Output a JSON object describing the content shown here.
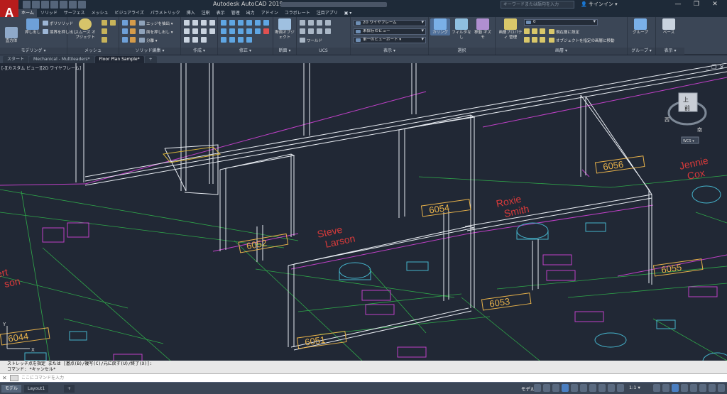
{
  "app": {
    "logo": "A",
    "title": "Autodesk AutoCAD 2019 - ",
    "search_placeholder": "キーワードまたは語句を入力",
    "user": "サインイン",
    "quick_access_icons": [
      "new-icon",
      "open-icon",
      "save-icon",
      "saveas-icon",
      "print-icon",
      "undo-icon",
      "redo-icon"
    ]
  },
  "window": {
    "minimize": "—",
    "restore": "❐",
    "close": "✕"
  },
  "ribbon_tabs": [
    {
      "label": "ホーム",
      "active": true
    },
    {
      "label": "ソリッド"
    },
    {
      "label": "サーフェス"
    },
    {
      "label": "メッシュ"
    },
    {
      "label": "ビジュアライズ"
    },
    {
      "label": "パラメトリック"
    },
    {
      "label": "挿入"
    },
    {
      "label": "注釈"
    },
    {
      "label": "表示"
    },
    {
      "label": "管理"
    },
    {
      "label": "出力"
    },
    {
      "label": "アドイン"
    },
    {
      "label": "コラボレート"
    },
    {
      "label": "注目アプリ"
    },
    {
      "label": "▣ ▾"
    }
  ],
  "ribbon": {
    "modeling": {
      "title": "モデリング ▾",
      "box": "直方体",
      "extrude": "押し出し",
      "polysolid": "ポリソリッド",
      "presspull": "境界を押し出し"
    },
    "mesh": {
      "title": "メッシュ",
      "smooth": "スムーズ オブジェクト"
    },
    "solid_edit": {
      "title": "ソリッド編集 ▾",
      "edge": "エッジを抽出 ▾",
      "face": "面を押し出し ▾",
      "separate": "分離 ▾"
    },
    "draw": {
      "title": "作成 ▾"
    },
    "modify": {
      "title": "修正 ▾"
    },
    "section": {
      "title": "断面 ▾",
      "plane": "断面オブジェクト"
    },
    "ucs": {
      "title": "UCS",
      "world": "ワールド"
    },
    "view": {
      "title": "表示 ▾",
      "visual_style": "2D ワイヤフレーム",
      "saved_view": "未保存のビュー",
      "single_viewport": "単一のビューポート ▾"
    },
    "selection": {
      "title": "選択",
      "culling": "カリング",
      "filter": "フィルタなし",
      "gizmo": "移動 ギズモ"
    },
    "layers": {
      "title": "画層 ▾",
      "properties": "画層プロパティ 管理",
      "current_layer": "0",
      "make_current": "現在層に設定",
      "match": "オブジェクトを指定の画層に移動"
    },
    "groups": {
      "title": "グループ ▾",
      "group": "グループ"
    },
    "base_view": {
      "title": "表示 ▾",
      "base": "ベース"
    }
  },
  "doc_tabs": [
    {
      "label": "スタート"
    },
    {
      "label": "Mechanical - Multileaders*"
    },
    {
      "label": "Floor Plan Sample*",
      "active": true
    },
    {
      "label": "+"
    }
  ],
  "viewport": {
    "label": "[-][カスタム ビュー][2D ワイヤフレーム]",
    "controls": {
      "minimize": "_",
      "restore": "❐",
      "close": "✕"
    },
    "viewcube": {
      "top": "上",
      "front": "前",
      "west": "西",
      "south": "南",
      "wcs": "WCS ▾"
    },
    "rooms": [
      {
        "number": "6051",
        "color": "#e8b24a"
      },
      {
        "number": "6052",
        "color": "#e8b24a"
      },
      {
        "number": "6053",
        "color": "#e8b24a"
      },
      {
        "number": "6054",
        "color": "#e8b24a"
      },
      {
        "number": "6055",
        "color": "#e8b24a"
      },
      {
        "number": "6056",
        "color": "#e8b24a"
      },
      {
        "number": "6044",
        "color": "#e8b24a"
      }
    ],
    "names": [
      {
        "first": "Steve",
        "last": "Larson"
      },
      {
        "first": "Roxie",
        "last": "Smith"
      },
      {
        "first": "Jennie",
        "last": "Cox"
      },
      {
        "first": "ert",
        "last": "son"
      }
    ],
    "ucs": {
      "x": "X",
      "y": "Y"
    }
  },
  "command": {
    "history1": "ストレッチ点を指定 または [基点(B)/複写(C)/元に戻す(U)/終了(X)]:",
    "history2": "コマンド: *キャンセル*",
    "placeholder": "ここにコマンドを入力"
  },
  "status": {
    "layout_tabs": [
      {
        "label": "モデル",
        "active": true
      },
      {
        "label": "Layout1"
      },
      {
        "label": "+"
      }
    ],
    "model": "モデル",
    "scale": "1:1 ▾"
  },
  "colors": {
    "wall": "#e8ecf2",
    "magenta": "#c040c8",
    "green": "#33b84a",
    "cyan": "#45b4cc",
    "red": "#d83a3a",
    "yellow": "#d8b43a"
  }
}
